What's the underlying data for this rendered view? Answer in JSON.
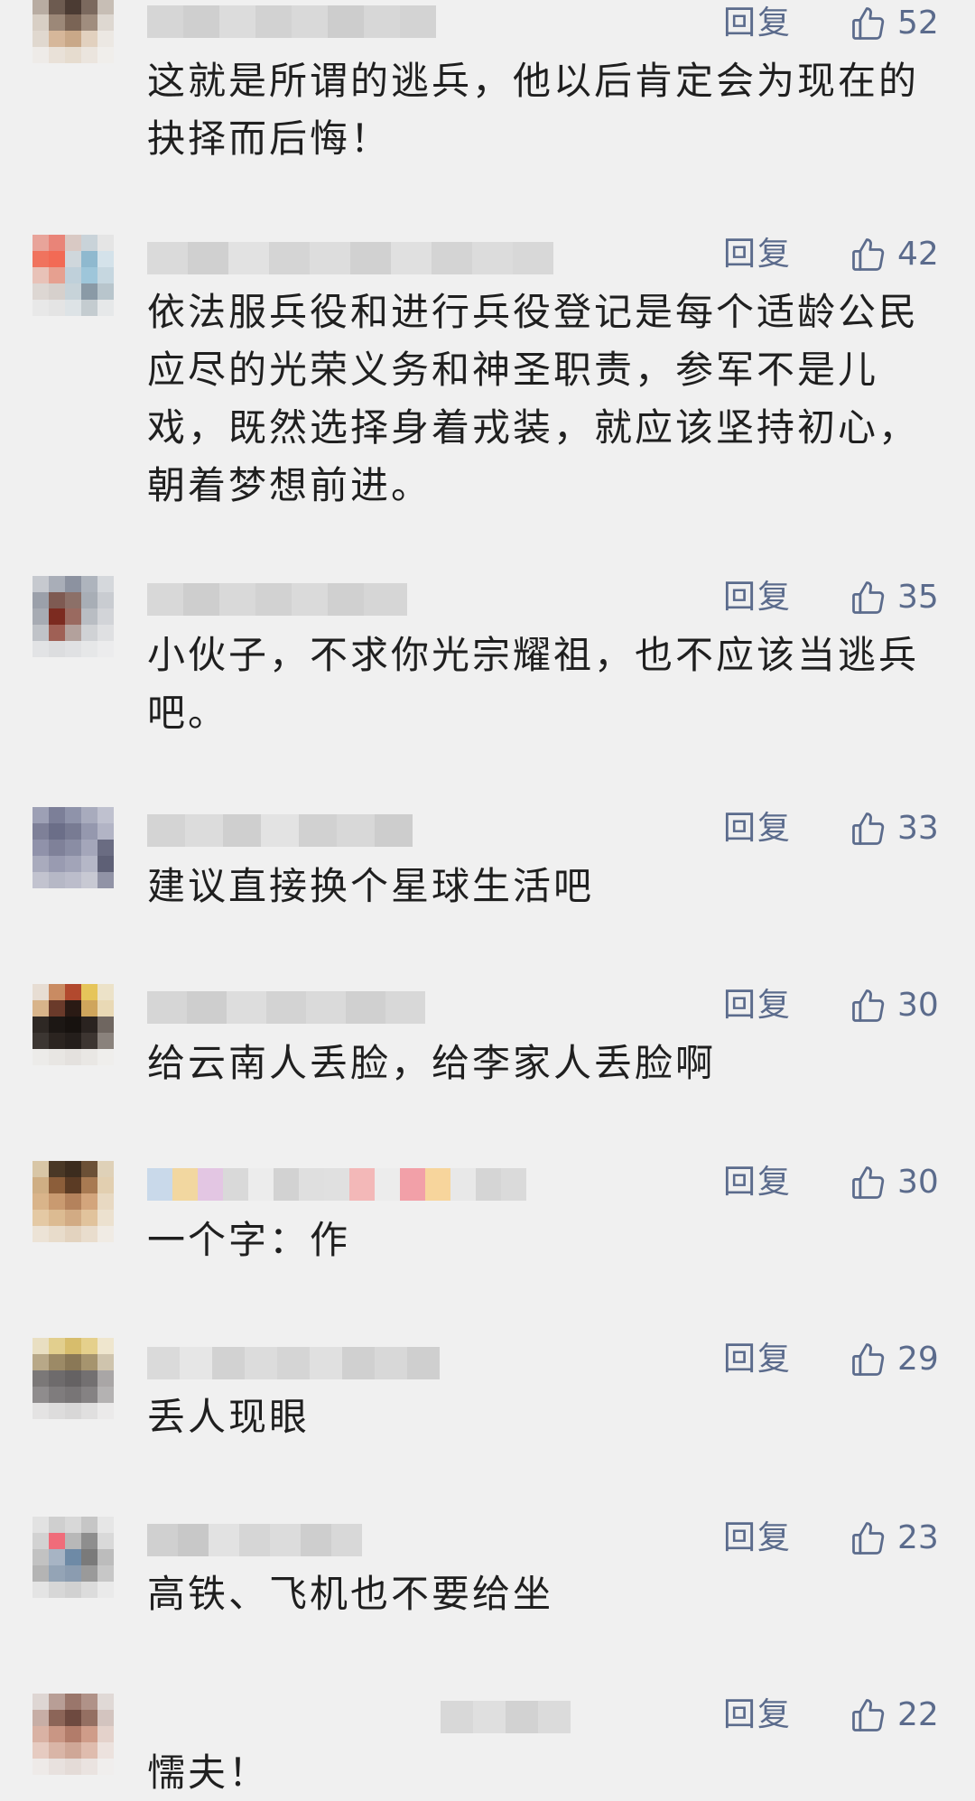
{
  "labels": {
    "reply": "回复"
  },
  "colors": {
    "background": "#f0f0f0",
    "meta_text": "#5b6b8c",
    "body_text": "#1f1f1f"
  },
  "comments": [
    {
      "text": "这就是所谓的逃兵，他以后肯定会为现在的抉择而后悔！",
      "likes": "52"
    },
    {
      "text": "依法服兵役和进行兵役登记是每个适龄公民应尽的光荣义务和神圣职责，参军不是儿戏，既然选择身着戎装，就应该坚持初心，朝着梦想前进。",
      "likes": "42"
    },
    {
      "text": "小伙子，不求你光宗耀祖，也不应该当逃兵吧。",
      "likes": "35"
    },
    {
      "text": "建议直接换个星球生活吧",
      "likes": "33"
    },
    {
      "text": "给云南人丢脸，给李家人丢脸啊",
      "likes": "30"
    },
    {
      "text": "一个字：作",
      "likes": "30"
    },
    {
      "text": "丢人现眼",
      "likes": "29"
    },
    {
      "text": "高铁、飞机也不要给坐",
      "likes": "23"
    },
    {
      "text": "懦夫！",
      "likes": "22"
    }
  ],
  "icons": {
    "like": "thumbs-up-outline-icon"
  }
}
